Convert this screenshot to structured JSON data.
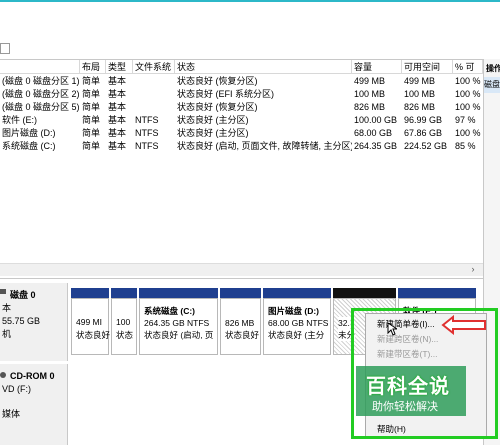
{
  "columns": [
    "布局",
    "类型",
    "文件系统",
    "状态",
    "容量",
    "可用空间",
    "% 可"
  ],
  "ops_header": "操作",
  "ops_item": "磁盘",
  "volumes": [
    {
      "name": "(磁盘 0 磁盘分区 1)",
      "layout": "简单",
      "type": "基本",
      "fs": "",
      "status": "状态良好 (恢复分区)",
      "capacity": "499 MB",
      "free": "499 MB",
      "pct": "100 %"
    },
    {
      "name": "(磁盘 0 磁盘分区 2)",
      "layout": "简单",
      "type": "基本",
      "fs": "",
      "status": "状态良好 (EFI 系统分区)",
      "capacity": "100 MB",
      "free": "100 MB",
      "pct": "100 %"
    },
    {
      "name": "(磁盘 0 磁盘分区 5)",
      "layout": "简单",
      "type": "基本",
      "fs": "",
      "status": "状态良好 (恢复分区)",
      "capacity": "826 MB",
      "free": "826 MB",
      "pct": "100 %"
    },
    {
      "name": "软件 (E:)",
      "layout": "简单",
      "type": "基本",
      "fs": "NTFS",
      "status": "状态良好 (主分区)",
      "capacity": "100.00 GB",
      "free": "96.99 GB",
      "pct": "97 %"
    },
    {
      "name": "图片磁盘 (D:)",
      "layout": "简单",
      "type": "基本",
      "fs": "NTFS",
      "status": "状态良好 (主分区)",
      "capacity": "68.00 GB",
      "free": "67.86 GB",
      "pct": "100 %"
    },
    {
      "name": "系统磁盘 (C:)",
      "layout": "简单",
      "type": "基本",
      "fs": "NTFS",
      "status": "状态良好 (启动, 页面文件, 故障转储, 主分区)",
      "capacity": "264.35 GB",
      "free": "224.52 GB",
      "pct": "85 %"
    }
  ],
  "disk0": {
    "title": "磁盘 0",
    "line2": "本",
    "line3": "55.75 GB",
    "line4": "机"
  },
  "cdrom": {
    "title": "CD-ROM 0",
    "line2": "VD (F:)",
    "line3": "媒体"
  },
  "partitions": {
    "p1": {
      "size": "499 MI",
      "status": "状态良好"
    },
    "p2": {
      "size": "100",
      "status": "状态"
    },
    "p3": {
      "name": "系统磁盘 (C:)",
      "size": "264.35 GB NTFS",
      "status": "状态良好 (启动, 页"
    },
    "p4": {
      "size": "826 MB",
      "status": "状态良好"
    },
    "p5": {
      "name": "图片磁盘 (D:)",
      "size": "68.00 GB NTFS",
      "status": "状态良好 (主分"
    },
    "p6": {
      "size": "32.",
      "status": "未分"
    },
    "p7": {
      "name": "软件 (E:)"
    }
  },
  "context_menu": {
    "new_simple": "新建简单卷(I)...",
    "new_spanned": "新建跨区卷(N)...",
    "new_striped": "新建带区卷(T)...",
    "help": "帮助(H)"
  },
  "watermark": {
    "title": "百科全说",
    "subtitle": "助你轻松解决"
  },
  "colors": {
    "bar": "#1f3f8f",
    "highlight": "#22cc22",
    "arrow": "#e03030"
  }
}
